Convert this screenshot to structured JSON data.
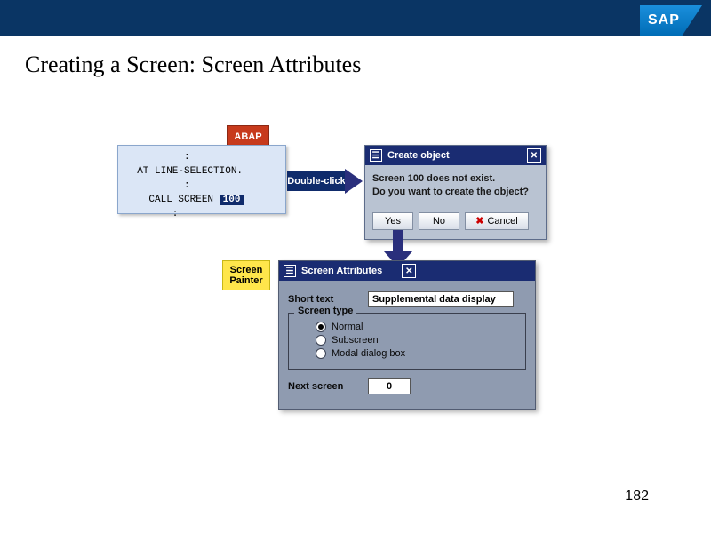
{
  "header": {
    "logo_text": "SAP"
  },
  "title": "Creating a Screen: Screen Attributes",
  "abap": {
    "tag": "ABAP",
    "line1": "          :",
    "line2": "  AT LINE-SELECTION.",
    "line3": "          :",
    "line4_pre": "    CALL SCREEN ",
    "screen_number": "100",
    "line5": "        :"
  },
  "double_click": "Double-click",
  "create_dialog": {
    "title": "Create object",
    "msg1": "Screen 100 does not exist.",
    "msg2": "Do you want to create the object?",
    "yes": "Yes",
    "no": "No",
    "cancel": "Cancel"
  },
  "screen_painter_tag_line1": "Screen",
  "screen_painter_tag_line2": "Painter",
  "attr_dialog": {
    "title": "Screen Attributes",
    "short_text_label": "Short text",
    "short_text_value": "Supplemental data display",
    "group_title": "Screen type",
    "opt_normal": "Normal",
    "opt_subscreen": "Subscreen",
    "opt_modal": "Modal dialog box",
    "next_screen_label": "Next screen",
    "next_screen_value": "0"
  },
  "page_number": "182"
}
